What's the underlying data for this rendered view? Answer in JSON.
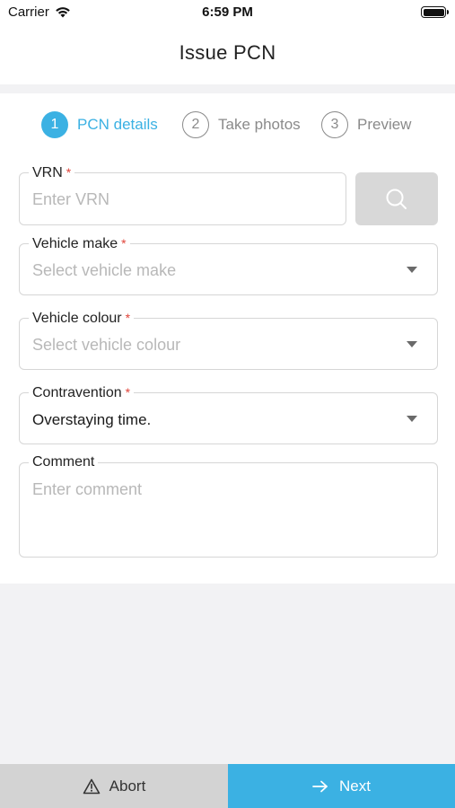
{
  "status_bar": {
    "carrier": "Carrier",
    "time": "6:59 PM",
    "icons": [
      "wifi-icon",
      "battery-icon"
    ]
  },
  "header": {
    "title": "Issue PCN"
  },
  "stepper": {
    "steps": [
      {
        "number": "1",
        "label": "PCN details",
        "state": "active"
      },
      {
        "number": "2",
        "label": "Take photos",
        "state": "inactive"
      },
      {
        "number": "3",
        "label": "Preview",
        "state": "inactive"
      }
    ]
  },
  "form": {
    "vrn": {
      "label": "VRN",
      "required": "*",
      "placeholder": "Enter VRN",
      "value": ""
    },
    "search_button": {
      "icon": "search-icon"
    },
    "vehicle_make": {
      "label": "Vehicle make",
      "required": "*",
      "placeholder": "Select vehicle make",
      "value": ""
    },
    "vehicle_colour": {
      "label": "Vehicle colour",
      "required": "*",
      "placeholder": "Select vehicle colour",
      "value": ""
    },
    "contravention": {
      "label": "Contravention",
      "required": "*",
      "placeholder": "",
      "value": "Overstaying time."
    },
    "comment": {
      "label": "Comment",
      "placeholder": "Enter comment",
      "value": ""
    }
  },
  "footer": {
    "abort_label": "Abort",
    "abort_icon": "warning-icon",
    "next_label": "Next",
    "next_icon": "arrow-right-icon"
  },
  "colors": {
    "accent": "#3bb1e3",
    "required": "#e0443a",
    "abort_bg": "#d3d3d3"
  }
}
